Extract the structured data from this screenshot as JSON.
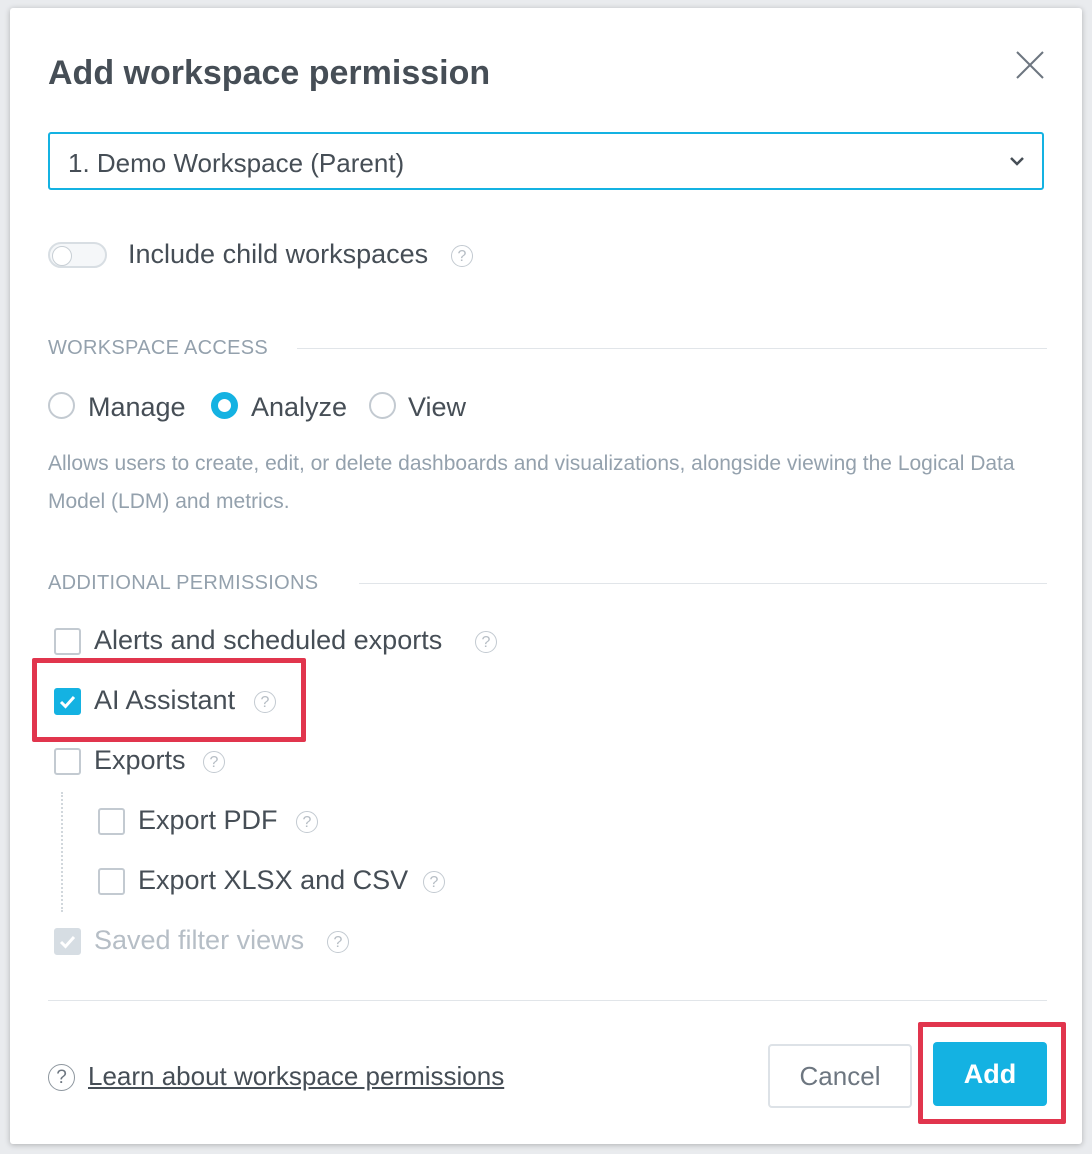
{
  "dialog": {
    "title": "Add workspace permission",
    "workspace_select": {
      "value": "1. Demo Workspace (Parent)"
    },
    "include_children": {
      "label": "Include child workspaces",
      "enabled": false
    },
    "workspace_access": {
      "heading": "WORKSPACE ACCESS",
      "options": [
        {
          "label": "Manage",
          "selected": false
        },
        {
          "label": "Analyze",
          "selected": true
        },
        {
          "label": "View",
          "selected": false
        }
      ],
      "description": "Allows users to create, edit, or delete dashboards and visualizations, alongside viewing the Logical Data Model (LDM) and metrics."
    },
    "additional_permissions": {
      "heading": "ADDITIONAL PERMISSIONS",
      "items": [
        {
          "label": "Alerts and scheduled exports",
          "checked": false
        },
        {
          "label": "AI Assistant",
          "checked": true
        },
        {
          "label": "Exports",
          "checked": false
        },
        {
          "label": "Export PDF",
          "checked": false
        },
        {
          "label": "Export XLSX and CSV",
          "checked": false
        },
        {
          "label": "Saved filter views",
          "checked": true,
          "disabled": true
        }
      ]
    },
    "footer": {
      "learn_link": "Learn about workspace permissions",
      "cancel_label": "Cancel",
      "add_label": "Add"
    }
  },
  "colors": {
    "accent": "#14b2e2",
    "highlight": "#e1354d",
    "text": "#464e56",
    "muted": "#94a1ad"
  },
  "icons": {
    "close": "close-icon",
    "chevron": "chevron-down-icon",
    "help": "question-circle-icon",
    "check": "checkmark-icon"
  }
}
